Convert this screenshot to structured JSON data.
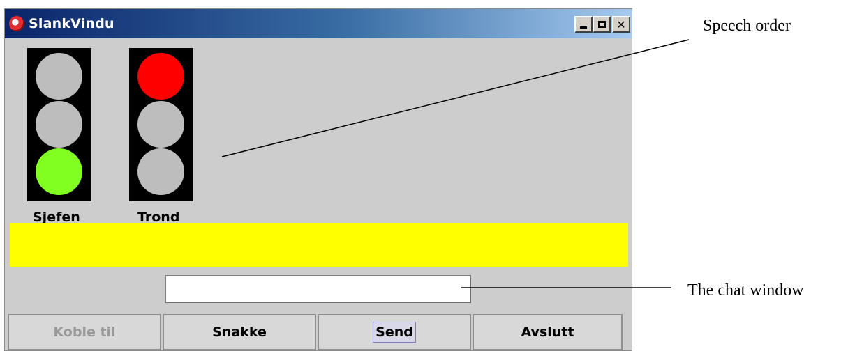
{
  "window": {
    "title": "SlankVindu",
    "minimize_label": "",
    "maximize_label": "",
    "close_label": "✕"
  },
  "lights": [
    {
      "name": "Sjefen",
      "active": "green"
    },
    {
      "name": "Trond",
      "active": "red"
    }
  ],
  "colors": {
    "red": "#ff0000",
    "green": "#80ff20",
    "off": "#bdbdbd",
    "status_bar": "#ffff00",
    "window_bg": "#cdcdcd"
  },
  "chat": {
    "value": "",
    "placeholder": ""
  },
  "buttons": {
    "connect": "Koble til",
    "talk": "Snakke",
    "send": "Send",
    "quit": "Avslutt"
  },
  "annotations": {
    "speech_order": "Speech order",
    "chat_window": "The chat window"
  }
}
